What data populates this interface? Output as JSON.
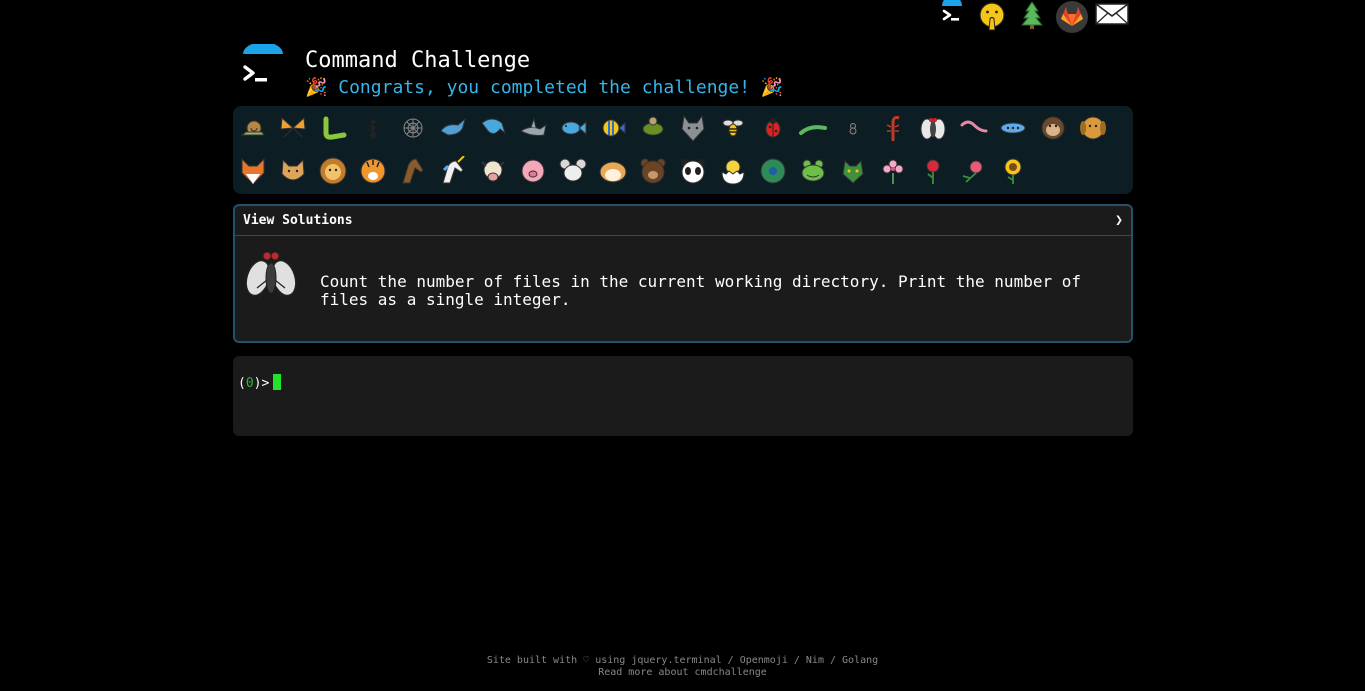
{
  "header": {
    "title": "Command Challenge",
    "subtitle_prefix": "🎉",
    "subtitle": " Congrats, you completed the challenge! ",
    "subtitle_suffix": "🎉"
  },
  "top_icons": [
    "terminal-logo-icon",
    "shushing-face-icon",
    "tree-icon",
    "gitlab-icon",
    "mail-icon"
  ],
  "emoji_bar": {
    "row1": [
      "snail",
      "butterfly",
      "caterpillar",
      "ant",
      "spider-web",
      "whale",
      "dolphin",
      "shark",
      "fish",
      "tropical-fish",
      "turtle",
      "wolf",
      "bee",
      "lady-beetle",
      "lizard",
      "spider",
      "scorpion",
      "fly",
      "worm",
      "microbe",
      "monkey",
      "dog"
    ],
    "row2": [
      "fox",
      "cat",
      "lion",
      "tiger",
      "horse",
      "unicorn",
      "cow",
      "pig",
      "mouse",
      "hamster",
      "bear",
      "panda",
      "hatching-chick",
      "peacock",
      "frog",
      "dragon",
      "cherry-blossom",
      "rose",
      "hibiscus",
      "sunflower"
    ]
  },
  "solutions": {
    "label": "View Solutions",
    "chevron": "❯",
    "task_text": "Count the number of files in the current working directory. Print the number of files as a single integer."
  },
  "terminal": {
    "prompt_open": "(",
    "prompt_code": "0",
    "prompt_close": ")>"
  },
  "footer": {
    "line1": "Site built with ♡ using jquery.terminal / Openmoji / Nim / Golang",
    "line2": "Read more about cmdchallenge"
  },
  "colors": {
    "accent": "#35b5ea",
    "panel_border": "#23506a",
    "cursor": "#21e32b"
  }
}
